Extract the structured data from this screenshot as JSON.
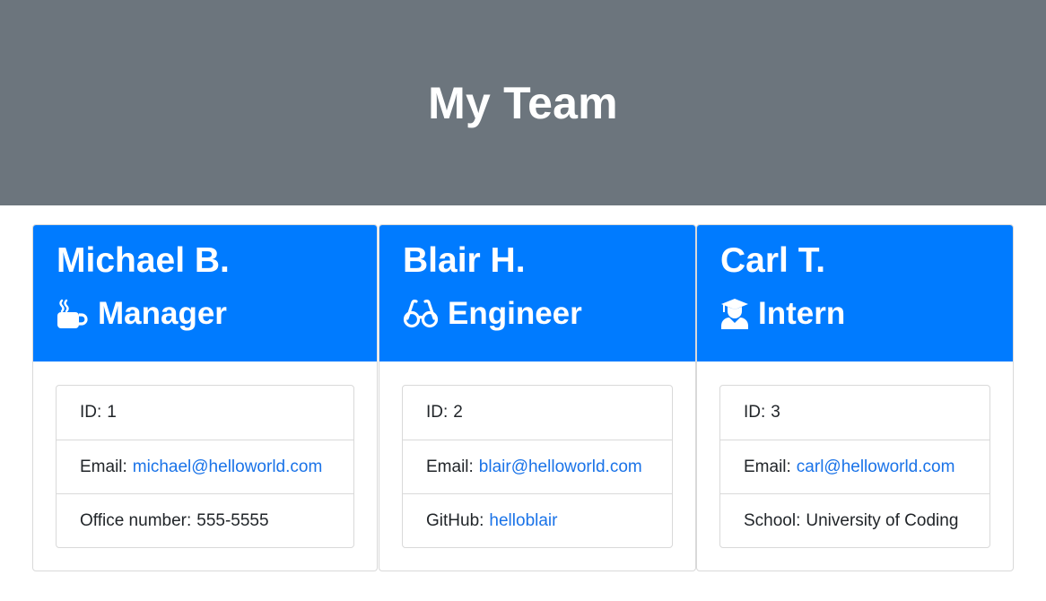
{
  "header": {
    "title": "My Team"
  },
  "employees": [
    {
      "name": "Michael B.",
      "role": "Manager",
      "icon": "coffee-mug-icon",
      "id_label": "ID:",
      "id": "1",
      "email_label": "Email:",
      "email": "michael@helloworld.com",
      "extra_label": "Office number:",
      "extra_value": "555-5555"
    },
    {
      "name": "Blair H.",
      "role": "Engineer",
      "icon": "glasses-icon",
      "id_label": "ID:",
      "id": "2",
      "email_label": "Email:",
      "email": "blair@helloworld.com",
      "extra_label": "GitHub:",
      "extra_value": "helloblair"
    },
    {
      "name": "Carl T.",
      "role": "Intern",
      "icon": "graduate-icon",
      "id_label": "ID:",
      "id": "3",
      "email_label": "Email:",
      "email": "carl@helloworld.com",
      "extra_label": "School:",
      "extra_value": "University of Coding"
    }
  ],
  "colors": {
    "header_bg": "#6c757d",
    "card_header_bg": "#007bff",
    "link": "#1a73e8"
  }
}
